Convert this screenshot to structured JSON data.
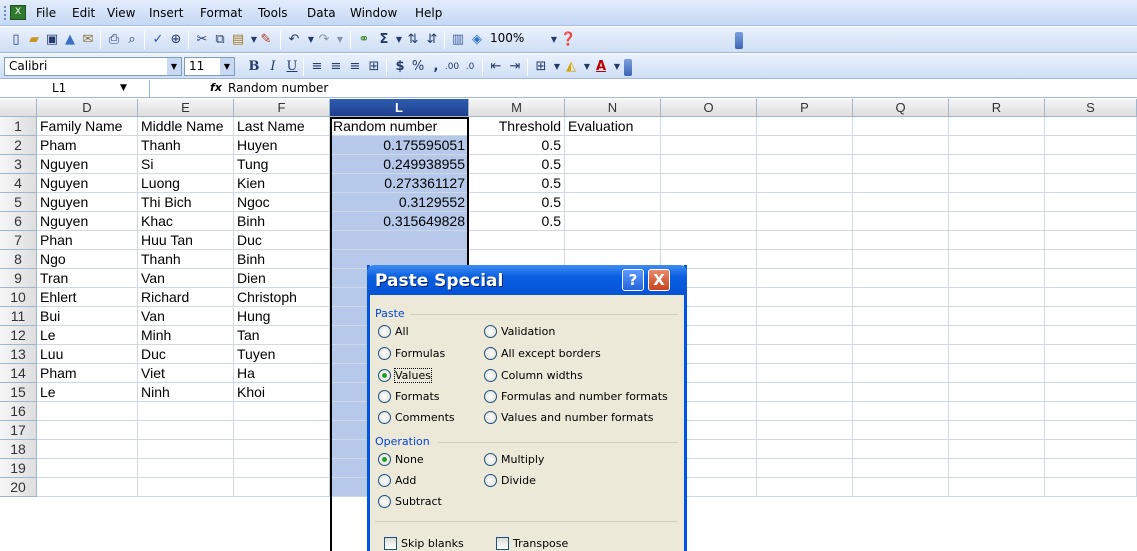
{
  "menu": [
    "File",
    "Edit",
    "View",
    "Insert",
    "Format",
    "Tools",
    "Data",
    "Window",
    "Help"
  ],
  "toolbar": {
    "zoom": "100%"
  },
  "format_toolbar": {
    "font": "Calibri",
    "size": "11"
  },
  "formula_bar": {
    "name_box": "L1",
    "fx": "fx",
    "content": "Random number"
  },
  "columns": [
    "D",
    "E",
    "F",
    "L",
    "M",
    "N",
    "O",
    "P",
    "Q",
    "R",
    "S"
  ],
  "rows": [
    {
      "n": "1",
      "d": "Family Name",
      "e": "Middle Name",
      "f": "Last Name",
      "l": "Random number",
      "m": "Threshold",
      "nn": "Evaluation"
    },
    {
      "n": "2",
      "d": "Pham",
      "e": "Thanh",
      "f": "Huyen",
      "l": "0.175595051",
      "m": "0.5",
      "nn": ""
    },
    {
      "n": "3",
      "d": "Nguyen",
      "e": "Si",
      "f": "Tung",
      "l": "0.249938955",
      "m": "0.5",
      "nn": ""
    },
    {
      "n": "4",
      "d": "Nguyen",
      "e": "Luong",
      "f": "Kien",
      "l": "0.273361127",
      "m": "0.5",
      "nn": ""
    },
    {
      "n": "5",
      "d": "Nguyen",
      "e": "Thi Bich",
      "f": "Ngoc",
      "l": "0.3129552",
      "m": "0.5",
      "nn": ""
    },
    {
      "n": "6",
      "d": "Nguyen",
      "e": "Khac",
      "f": "Binh",
      "l": "0.315649828",
      "m": "0.5",
      "nn": ""
    },
    {
      "n": "7",
      "d": "Phan",
      "e": "Huu Tan",
      "f": "Duc",
      "l": "",
      "m": "",
      "nn": ""
    },
    {
      "n": "8",
      "d": "Ngo",
      "e": "Thanh",
      "f": "Binh",
      "l": "",
      "m": "",
      "nn": ""
    },
    {
      "n": "9",
      "d": "Tran",
      "e": "Van",
      "f": "Dien",
      "l": "",
      "m": "",
      "nn": ""
    },
    {
      "n": "10",
      "d": "Ehlert",
      "e": "Richard",
      "f": "Christoph",
      "l": "",
      "m": "",
      "nn": ""
    },
    {
      "n": "11",
      "d": "Bui",
      "e": "Van",
      "f": "Hung",
      "l": "",
      "m": "",
      "nn": ""
    },
    {
      "n": "12",
      "d": "Le",
      "e": "Minh",
      "f": "Tan",
      "l": "",
      "m": "",
      "nn": ""
    },
    {
      "n": "13",
      "d": "Luu",
      "e": "Duc",
      "f": "Tuyen",
      "l": "",
      "m": "",
      "nn": ""
    },
    {
      "n": "14",
      "d": "Pham",
      "e": "Viet",
      "f": "Ha",
      "l": "",
      "m": "",
      "nn": ""
    },
    {
      "n": "15",
      "d": "Le",
      "e": "Ninh",
      "f": "Khoi",
      "l": "",
      "m": "",
      "nn": ""
    },
    {
      "n": "16",
      "d": "",
      "e": "",
      "f": "",
      "l": "",
      "m": "",
      "nn": ""
    },
    {
      "n": "17",
      "d": "",
      "e": "",
      "f": "",
      "l": "",
      "m": "",
      "nn": ""
    },
    {
      "n": "18",
      "d": "",
      "e": "",
      "f": "",
      "l": "",
      "m": "",
      "nn": ""
    },
    {
      "n": "19",
      "d": "",
      "e": "",
      "f": "",
      "l": "",
      "m": "",
      "nn": ""
    },
    {
      "n": "20",
      "d": "",
      "e": "",
      "f": "",
      "l": "",
      "m": "",
      "nn": ""
    }
  ],
  "dialog": {
    "title": "Paste Special",
    "help": "?",
    "close": "X",
    "paste_label": "Paste",
    "paste_options": [
      "All",
      "Formulas",
      "Values",
      "Formats",
      "Comments",
      "Validation",
      "All except borders",
      "Column widths",
      "Formulas and number formats",
      "Values and number formats"
    ],
    "paste_selected": "Values",
    "operation_label": "Operation",
    "operation_options": [
      "None",
      "Add",
      "Subtract",
      "Multiply",
      "Divide"
    ],
    "operation_selected": "None",
    "skip_blanks": "Skip blanks",
    "transpose": "Transpose"
  }
}
